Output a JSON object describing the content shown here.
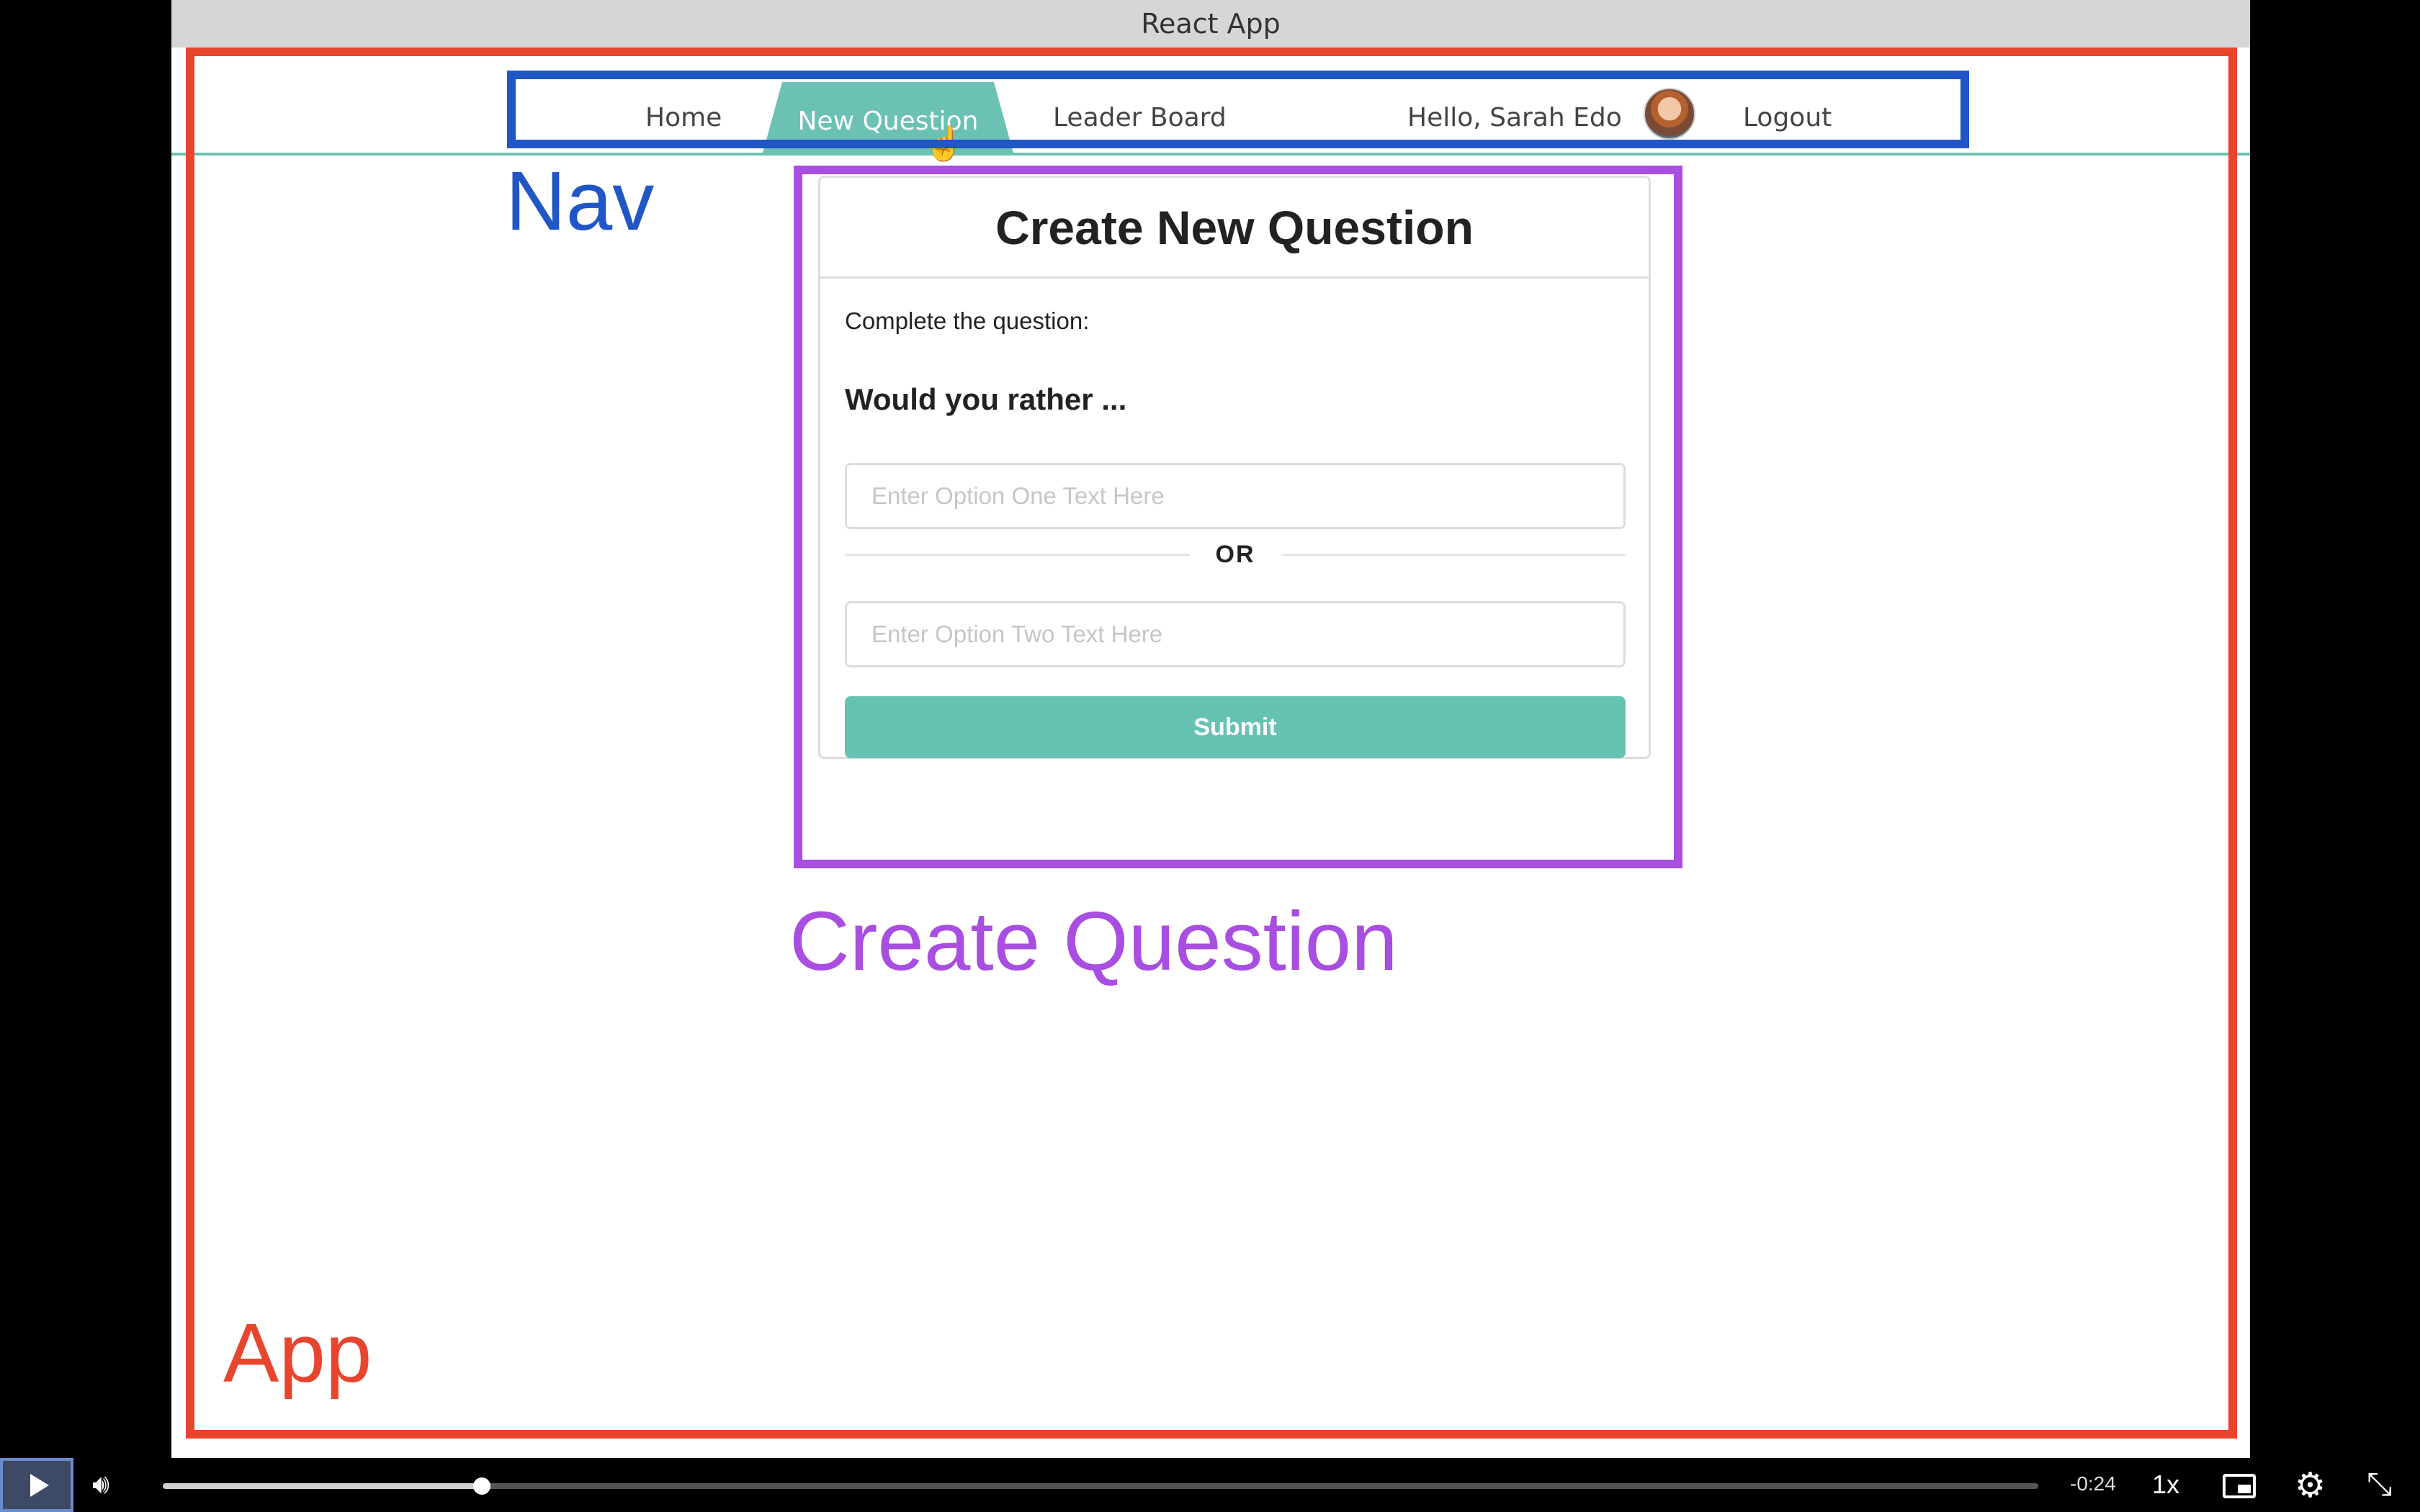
{
  "window": {
    "title": "React App"
  },
  "nav": {
    "items": [
      {
        "label": "Home",
        "active": false
      },
      {
        "label": "New Question",
        "active": true
      },
      {
        "label": "Leader Board",
        "active": false
      }
    ],
    "greeting": "Hello, Sarah Edo",
    "logout_label": "Logout",
    "accent_color": "#6ac1b4"
  },
  "create_question": {
    "title": "Create New Question",
    "instruction": "Complete the question:",
    "prompt": "Would you rather ...",
    "option_one_placeholder": "Enter Option One Text Here",
    "option_two_placeholder": "Enter Option Two Text Here",
    "divider_text": "OR",
    "submit_label": "Submit",
    "submit_color": "#66c2b3"
  },
  "annotations": {
    "nav_label": "Nav",
    "create_label": "Create Question",
    "app_label": "App",
    "nav_color": "#2056c6",
    "create_color": "#a84ee0",
    "app_color": "#e8452f"
  },
  "video_controls": {
    "time_remaining": "-0:24",
    "speed": "1x",
    "progress_fraction": 0.17,
    "icons": [
      "play-icon",
      "volume-icon",
      "picture-in-picture-icon",
      "gear-icon",
      "exit-fullscreen-icon"
    ]
  }
}
